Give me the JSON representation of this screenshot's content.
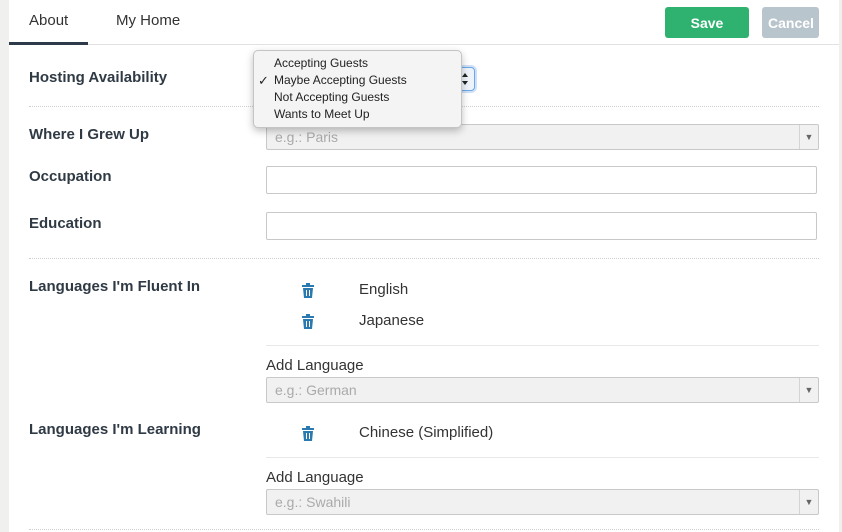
{
  "tabs": [
    {
      "label": "About",
      "active": true
    },
    {
      "label": "My Home",
      "active": false
    }
  ],
  "actions": {
    "save_label": "Save",
    "cancel_label": "Cancel"
  },
  "colors": {
    "save": "#2fb170",
    "cancel": "#b9c5cd",
    "trash": "#2a7ab0",
    "focus": "#6aa9e9"
  },
  "hosting": {
    "label": "Hosting Availability",
    "options": [
      "Accepting Guests",
      "Maybe Accepting Guests",
      "Not Accepting Guests",
      "Wants to Meet Up"
    ],
    "selected": "Maybe Accepting Guests",
    "check_glyph": "✓"
  },
  "where_grew_up": {
    "label": "Where I Grew Up",
    "placeholder": "e.g.: Paris"
  },
  "occupation": {
    "label": "Occupation",
    "value": ""
  },
  "education": {
    "label": "Education",
    "value": ""
  },
  "fluent": {
    "label": "Languages I'm Fluent In",
    "languages": [
      "English",
      "Japanese"
    ],
    "add_label": "Add Language",
    "add_placeholder": "e.g.: German"
  },
  "learning": {
    "label": "Languages I'm Learning",
    "languages": [
      "Chinese (Simplified)"
    ],
    "add_label": "Add Language",
    "add_placeholder": "e.g.: Swahili"
  },
  "icons": {
    "trash": "trash-icon",
    "select_caret": "chevron-down-icon",
    "select_spinner": "up-down-arrows-icon"
  }
}
